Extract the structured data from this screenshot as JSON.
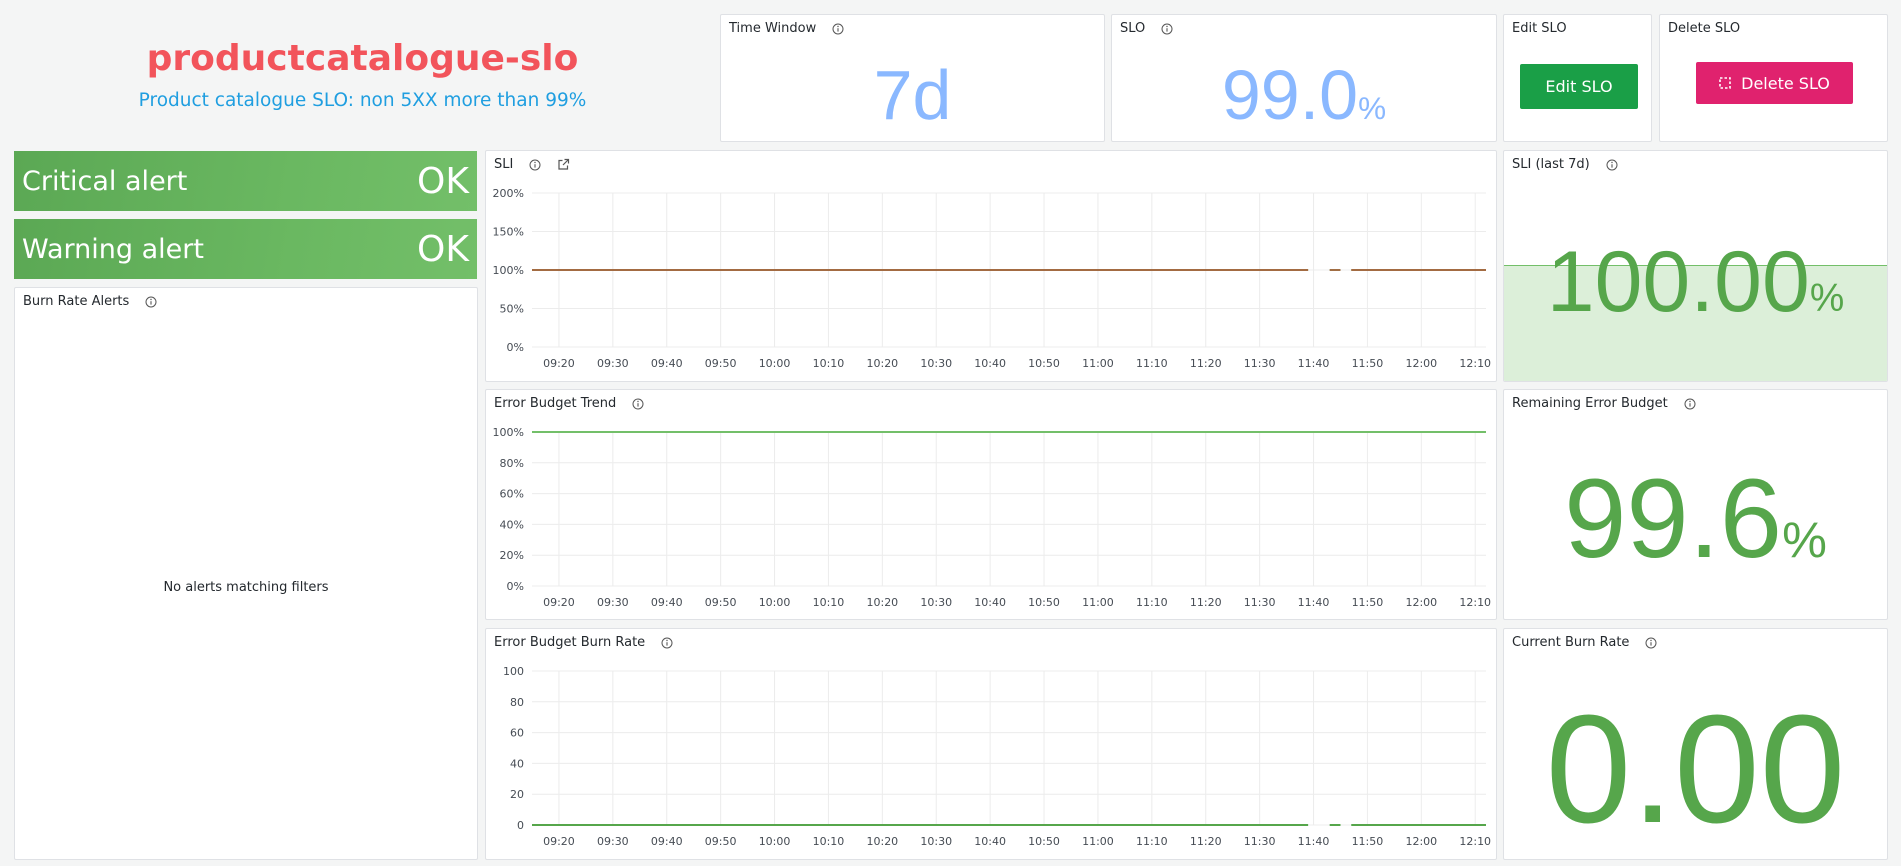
{
  "header": {
    "title": "productcatalogue-slo",
    "subtitle": "Product catalogue SLO: non 5XX more than 99%",
    "title_color": "#f2545b",
    "subtitle_color": "#1f9ee0"
  },
  "colors": {
    "blue_stat": "#8ab8ff",
    "green_stat": "#56a64b",
    "edit_button": "#1a9f47",
    "delete_button": "#e0226e",
    "line_green": "#73bf69",
    "line_red": "#c0392b",
    "sli_fill": "#dcefd9"
  },
  "time_window": {
    "title": "Time Window",
    "value": "7d"
  },
  "slo": {
    "title": "SLO",
    "value": "99.0",
    "unit": "%"
  },
  "edit_slo": {
    "title": "Edit SLO",
    "button_label": "Edit SLO"
  },
  "delete_slo": {
    "title": "Delete SLO",
    "button_label": "Delete SLO",
    "icon": "dashed-square-icon"
  },
  "alerts": {
    "critical": {
      "label": "Critical alert",
      "state": "OK"
    },
    "warning": {
      "label": "Warning alert",
      "state": "OK"
    }
  },
  "burn_rate_alerts": {
    "title": "Burn Rate Alerts",
    "empty_text": "No alerts matching filters"
  },
  "sli_last": {
    "title": "SLI (last 7d)",
    "value": "100.00",
    "unit": "%",
    "level": 0.5
  },
  "remaining_error_budget": {
    "title": "Remaining Error Budget",
    "value": "99.6",
    "unit": "%"
  },
  "current_burn_rate": {
    "title": "Current Burn Rate",
    "value": "0.00"
  },
  "charts": {
    "sli": {
      "title": "SLI"
    },
    "error_budget_trend": {
      "title": "Error Budget Trend"
    },
    "error_budget_burn_rate": {
      "title": "Error Budget Burn Rate"
    }
  },
  "chart_data": [
    {
      "type": "line",
      "title": "SLI",
      "x_ticks": [
        "09:20",
        "09:30",
        "09:40",
        "09:50",
        "10:00",
        "10:10",
        "10:20",
        "10:30",
        "10:40",
        "10:50",
        "11:00",
        "11:10",
        "11:20",
        "11:30",
        "11:40",
        "11:50",
        "12:00",
        "12:10"
      ],
      "y_ticks": [
        "200%",
        "150%",
        "100%",
        "50%",
        "0%"
      ],
      "ylim": [
        0,
        200
      ],
      "x_range": [
        "09:15",
        "12:12"
      ],
      "series": [
        {
          "color": "#73bf69",
          "segments": [
            {
              "x": [
                "09:15",
                "11:39"
              ],
              "y": [
                100,
                100
              ]
            },
            {
              "x": [
                "11:43",
                "11:45"
              ],
              "y": [
                100,
                100
              ]
            },
            {
              "x": [
                "11:47",
                "12:12"
              ],
              "y": [
                100,
                100
              ]
            }
          ]
        },
        {
          "color": "#c0392b",
          "segments": [
            {
              "x": [
                "09:15",
                "11:39"
              ],
              "y": [
                100,
                100
              ]
            },
            {
              "x": [
                "11:43",
                "11:45"
              ],
              "y": [
                100,
                100
              ]
            },
            {
              "x": [
                "11:47",
                "12:12"
              ],
              "y": [
                100,
                100
              ]
            }
          ]
        }
      ],
      "grid": true
    },
    {
      "type": "line",
      "title": "Error Budget Trend",
      "x_ticks": [
        "09:20",
        "09:30",
        "09:40",
        "09:50",
        "10:00",
        "10:10",
        "10:20",
        "10:30",
        "10:40",
        "10:50",
        "11:00",
        "11:10",
        "11:20",
        "11:30",
        "11:40",
        "11:50",
        "12:00",
        "12:10"
      ],
      "y_ticks": [
        "100%",
        "80%",
        "60%",
        "40%",
        "20%",
        "0%"
      ],
      "ylim": [
        0,
        100
      ],
      "x_range": [
        "09:15",
        "12:12"
      ],
      "series": [
        {
          "color": "#73bf69",
          "segments": [
            {
              "x": [
                "09:15",
                "12:12"
              ],
              "y": [
                100,
                100
              ]
            }
          ]
        }
      ],
      "grid": true
    },
    {
      "type": "line",
      "title": "Error Budget Burn Rate",
      "x_ticks": [
        "09:20",
        "09:30",
        "09:40",
        "09:50",
        "10:00",
        "10:10",
        "10:20",
        "10:30",
        "10:40",
        "10:50",
        "11:00",
        "11:10",
        "11:20",
        "11:30",
        "11:40",
        "11:50",
        "12:00",
        "12:10"
      ],
      "y_ticks": [
        "100",
        "80",
        "60",
        "40",
        "20",
        "0"
      ],
      "ylim": [
        0,
        100
      ],
      "x_range": [
        "09:15",
        "12:12"
      ],
      "series": [
        {
          "color": "#56a64b",
          "segments": [
            {
              "x": [
                "09:15",
                "11:39"
              ],
              "y": [
                0,
                0
              ]
            },
            {
              "x": [
                "11:43",
                "11:45"
              ],
              "y": [
                0,
                0
              ]
            },
            {
              "x": [
                "11:47",
                "12:12"
              ],
              "y": [
                0,
                0
              ]
            }
          ]
        }
      ],
      "grid": true
    }
  ]
}
